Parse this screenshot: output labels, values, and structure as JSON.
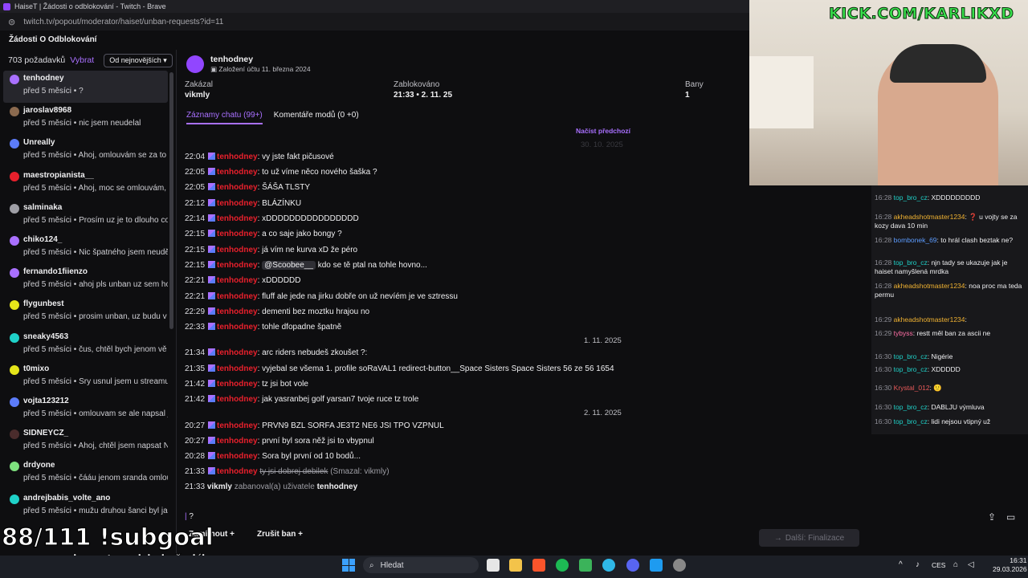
{
  "window_title": "HaiseT | Žádosti o odblokování - Twitch - Brave",
  "url": "twitch.tv/popout/moderator/haiset/unban-requests?id=11",
  "page_title": "Žádosti O Odblokování",
  "list": {
    "count": "703 požadavků",
    "select": "Vybrat",
    "sort": "Od nejnovějších",
    "items": [
      {
        "name": "tenhodney",
        "time": "před 5 měsíci",
        "msg": "?",
        "color": "#a970ff"
      },
      {
        "name": "jaroslav8968",
        "time": "před 5 měsíci",
        "msg": "nic jsem neudelal",
        "color": "#8b6a4f"
      },
      {
        "name": "Unreally",
        "time": "před 5 měsíci",
        "msg": "Ahoj, omlouvám se za to",
        "color": "#5c7cfa"
      },
      {
        "name": "maestropianista__",
        "time": "před 5 měsíci",
        "msg": "Ahoj, moc se omlouvám,",
        "color": "#e8202c"
      },
      {
        "name": "salminaka",
        "time": "před 5 měsíci",
        "msg": "Prosím uz je to dlouho co",
        "color": "#9e9ea5"
      },
      {
        "name": "chiko124_",
        "time": "před 5 měsíci",
        "msg": "Nic špatného jsem neudělal",
        "color": "#a970ff"
      },
      {
        "name": "fernando1fiienzo",
        "time": "před 5 měsíci",
        "msg": "ahoj pls unban uz sem ho",
        "color": "#a970ff"
      },
      {
        "name": "flygunbest",
        "time": "před 5 měsíci",
        "msg": "prosim unban, uz budu v",
        "color": "#e5e51a"
      },
      {
        "name": "sneaky4563",
        "time": "před 5 měsíci",
        "msg": "čus, chtěl bych jenom vě",
        "color": "#1fd1c8"
      },
      {
        "name": "t0mixo",
        "time": "před 5 měsíci",
        "msg": "Sry usnul jsem u streamu",
        "color": "#e5e51a"
      },
      {
        "name": "vojta123212",
        "time": "před 5 měsíci",
        "msg": "omlouvam se ale napsal j",
        "color": "#5c7cfa"
      },
      {
        "name": "SIDNEYCZ_",
        "time": "před 5 měsíci",
        "msg": "Ahoj, chtěl jsem napsat N",
        "color": "#4a2c2c"
      },
      {
        "name": "drdyone",
        "time": "před 5 měsíci",
        "msg": "čááu jenom sranda omlou",
        "color": "#7ee07e"
      },
      {
        "name": "andrejbabis_volte_ano",
        "time": "před 5 měsíci",
        "msg": "mužu druhou šanci byl ja",
        "color": "#1fd1c8"
      }
    ]
  },
  "user": {
    "name": "tenhodney",
    "created": "Založení účtu 11. března 2024",
    "banned_by_label": "Zakázal",
    "banned_by": "vikmly",
    "blocked_label": "Zablokováno",
    "blocked": "21:33 • 2. 11. 25",
    "bans_label": "Bany",
    "bans": "1"
  },
  "tabs": {
    "chat": "Záznamy chatu (99+)",
    "comments": "Komentáře modů (0 +0)"
  },
  "load_more": "Načíst předchozí",
  "dates": {
    "d0": "30. 10. 2025",
    "d1": "1. 11. 2025",
    "d2": "2. 11. 2025"
  },
  "chat": [
    {
      "t": "22:04",
      "m": "vy jste fakt pičusové"
    },
    {
      "t": "22:05",
      "m": "to už víme něco nového šaška ?"
    },
    {
      "t": "22:05",
      "m": "ŠÁŠA TLSTY"
    },
    {
      "t": "22:12",
      "m": "BLÁZÍNKU"
    },
    {
      "t": "22:14",
      "m": "xDDDDDDDDDDDDDDDD"
    },
    {
      "t": "22:15",
      "m": "a co saje jako bongy ?"
    },
    {
      "t": "22:15",
      "m": "já vím ne kurva xD že péro"
    },
    {
      "t": "22:15",
      "mention": "@Scoobee__",
      "m": "kdo se tě ptal na tohle hovno..."
    },
    {
      "t": "22:21",
      "m": "xDDDDDD"
    },
    {
      "t": "22:21",
      "m": "fluff ale jede na jirku dobře on už nevíém je ve sztressu"
    },
    {
      "t": "22:29",
      "m": "dementi bez moztku hrajou no"
    },
    {
      "t": "22:33",
      "m": "tohle dfopadne špatně"
    },
    {
      "t": "21:34",
      "m": "arc riders nebudeš zkoušet ?:"
    },
    {
      "t": "21:35",
      "m": "vyjebal se všema 1. profile soRaVAL1 redirect-button__Space Sisters Space Sisters 56 ze 56 1654"
    },
    {
      "t": "21:42",
      "m": "tz jsi bot vole"
    },
    {
      "t": "21:42",
      "m": "jak yasranbej golf yarsan7 tvoje ruce tz trole"
    },
    {
      "t": "20:27",
      "m": "PRVN9 BZL SORFA JE3T2 NE6 JSI TPO VZPNUL"
    },
    {
      "t": "20:27",
      "m": "první byl sora něž jsi to vbypnul"
    },
    {
      "t": "20:28",
      "m": "Sora byl první od 10 bodů..."
    },
    {
      "t": "21:33",
      "deleted": "ty jsi dobrej debilek",
      "note": "(Smazal: vikmly)"
    }
  ],
  "ban_line": {
    "t": "21:33",
    "mod": "vikmly",
    "text": "zabanoval(a) uživatele",
    "user": "tenhodney"
  },
  "input_value": "?",
  "buttons": {
    "reject": "Zamítnout",
    "unban": "Zrušit ban",
    "next": "Další: Finalizace"
  },
  "overlay": {
    "kick": "KICK.COM/KARLIKXD",
    "subgoal": "88/111 !subgoal",
    "sponsor": "sponzor dne: topd jak žolík"
  },
  "right_chat": [
    {
      "ts": "16:28",
      "user": "top_bro_cz",
      "color": "#1fd1c8",
      "msg": "XDDDDDDDDD"
    },
    {
      "ts": "16:28",
      "user": "akheadshotmaster1234",
      "color": "#f0b232",
      "msg": "❓ u vojty se za kozy dava 10 min"
    },
    {
      "ts": "16:28",
      "user": "bombonek_69",
      "color": "#5c9cff",
      "msg": "to hrál clash beztak ne?"
    },
    {
      "ts": "16:28",
      "user": "top_bro_cz",
      "color": "#1fd1c8",
      "msg": "njn tady se ukazuje jak je haiset namyšlená mrdka"
    },
    {
      "ts": "16:28",
      "user": "akheadshotmaster1234",
      "color": "#f0b232",
      "msg": "noa proc ma teda permu"
    },
    {
      "ts": "16:29",
      "user": "akheadshotmaster1234",
      "color": "#f0b232",
      "msg": ""
    },
    {
      "ts": "16:29",
      "user": "tybyss",
      "color": "#ff6fa5",
      "msg": "restt měl ban za ascii ne"
    },
    {
      "ts": "16:30",
      "user": "top_bro_cz",
      "color": "#1fd1c8",
      "msg": "Nigérie"
    },
    {
      "ts": "16:30",
      "user": "top_bro_cz",
      "color": "#1fd1c8",
      "msg": "XDDDDD"
    },
    {
      "ts": "16:30",
      "user": "Krystal_012",
      "color": "#e85a5a",
      "msg": "🙂"
    },
    {
      "ts": "16:30",
      "user": "top_bro_cz",
      "color": "#1fd1c8",
      "msg": "DABLJU výmluva"
    },
    {
      "ts": "16:30",
      "user": "top_bro_cz",
      "color": "#1fd1c8",
      "msg": "lidi nejsou vtipný už"
    }
  ],
  "taskbar": {
    "search": "Hledat",
    "lang": "CES",
    "time": "16:31",
    "date": "29.03.2026"
  }
}
